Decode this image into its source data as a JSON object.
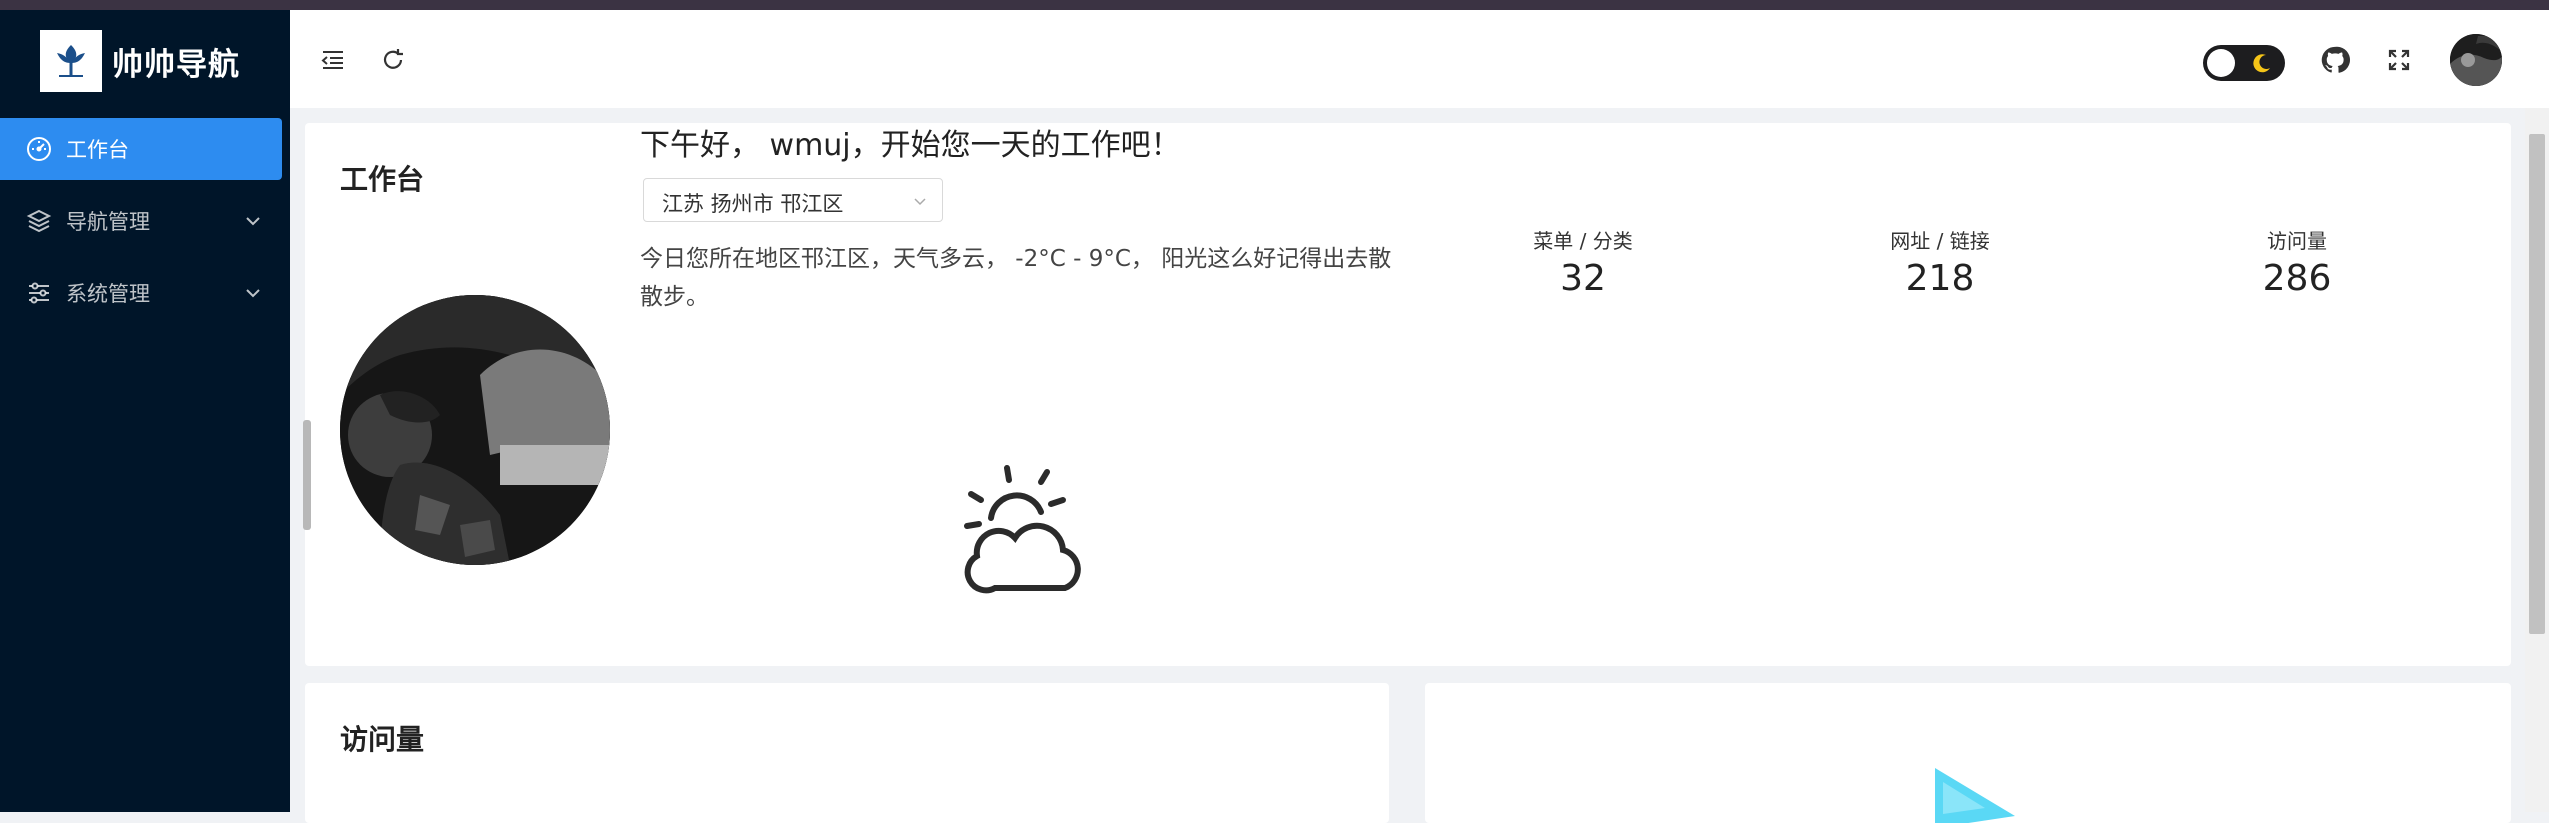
{
  "app": {
    "title": "帅帅导航"
  },
  "sidebar": {
    "items": [
      {
        "label": "工作台",
        "icon": "dashboard-icon",
        "active": true
      },
      {
        "label": "导航管理",
        "icon": "layers-icon",
        "active": false
      },
      {
        "label": "系统管理",
        "icon": "sliders-icon",
        "active": false
      }
    ]
  },
  "header": {
    "collapse_icon": "menu-fold-icon",
    "refresh_icon": "refresh-icon",
    "theme_icon": "moon-icon",
    "github_icon": "github-icon",
    "fullscreen_icon": "fullscreen-icon"
  },
  "workbench": {
    "title": "工作台",
    "greeting": "下午好， wmuj，开始您一天的工作吧！",
    "location": "江苏 扬州市 邗江区",
    "weather": "今日您所在地区邗江区，天气多云， -2°C - 9°C， 阳光这么好记得出去散散步。",
    "stats": [
      {
        "label": "菜单 / 分类",
        "value": "32"
      },
      {
        "label": "网址 / 链接",
        "value": "218"
      },
      {
        "label": "访问量",
        "value": "286"
      }
    ]
  },
  "visits_card": {
    "title": "访问量"
  },
  "colors": {
    "sidebar_bg": "#001529",
    "accent": "#2d8cf0",
    "toggle_bg": "#1d1d1f",
    "moon": "#f5c518"
  }
}
